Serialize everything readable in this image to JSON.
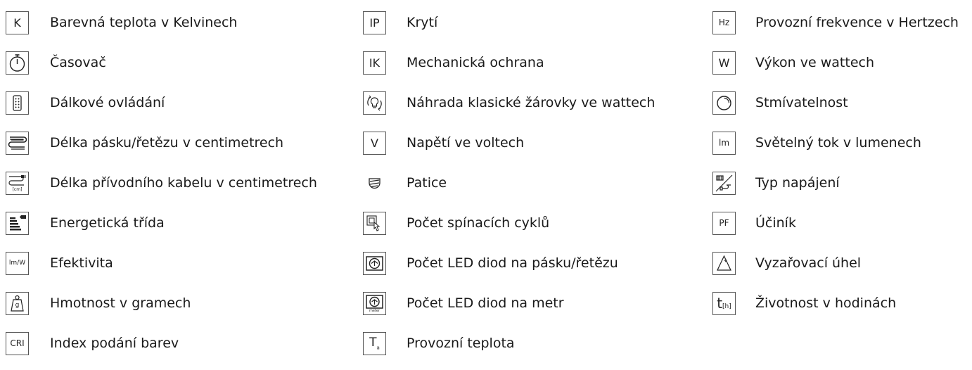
{
  "column1": [
    {
      "icon": "kelvin-icon",
      "icon_text": "K",
      "label": "Barevná teplota v Kelvinech"
    },
    {
      "icon": "timer-icon",
      "label": "Časovač"
    },
    {
      "icon": "remote-control-icon",
      "label": "Dálkové ovládání"
    },
    {
      "icon": "strip-length-icon",
      "label": "Délka pásku/řetězu v centimetrech"
    },
    {
      "icon": "cable-length-icon",
      "icon_text": "[cm]",
      "label": "Délka přívodního kabelu v centimetrech"
    },
    {
      "icon": "energy-class-icon",
      "label": "Energetická třída"
    },
    {
      "icon": "efficiency-icon",
      "icon_text": "lm/W",
      "label": "Efektivita"
    },
    {
      "icon": "weight-icon",
      "icon_text": "g",
      "label": "Hmotnost v gramech"
    },
    {
      "icon": "cri-icon",
      "icon_text": "CRI",
      "label": "Index podání barev"
    }
  ],
  "column2": [
    {
      "icon": "ip-icon",
      "icon_text": "IP",
      "label": "Krytí"
    },
    {
      "icon": "ik-icon",
      "icon_text": "IK",
      "label": "Mechanická ochrana"
    },
    {
      "icon": "bulb-replacement-icon",
      "label": "Náhrada klasické žárovky ve wattech"
    },
    {
      "icon": "voltage-icon",
      "icon_text": "V",
      "label": "Napětí ve voltech"
    },
    {
      "icon": "socket-icon",
      "label": "Patice"
    },
    {
      "icon": "switching-cycles-icon",
      "label": "Počet spínacích cyklů"
    },
    {
      "icon": "led-count-strip-icon",
      "label": "Počet LED diod na pásku/řetězu"
    },
    {
      "icon": "led-count-meter-icon",
      "icon_text": "meter",
      "label": "Počet LED diod na metr"
    },
    {
      "icon": "operating-temperature-icon",
      "icon_text": "Ta",
      "label": "Provozní teplota"
    }
  ],
  "column3": [
    {
      "icon": "hertz-icon",
      "icon_text": "Hz",
      "label": "Provozní frekvence v Hertzech"
    },
    {
      "icon": "watt-icon",
      "icon_text": "W",
      "label": "Výkon ve wattech"
    },
    {
      "icon": "dimmable-icon",
      "label": "Stmívatelnost"
    },
    {
      "icon": "lumen-icon",
      "icon_text": "lm",
      "label": "Světelný tok v lumenech"
    },
    {
      "icon": "power-supply-type-icon",
      "label": "Typ napájení"
    },
    {
      "icon": "power-factor-icon",
      "icon_text": "PF",
      "label": "Účiník"
    },
    {
      "icon": "beam-angle-icon",
      "label": "Vyzařovací úhel"
    },
    {
      "icon": "lifetime-icon",
      "icon_text": "t[h]",
      "label": "Životnost v hodinách"
    }
  ]
}
